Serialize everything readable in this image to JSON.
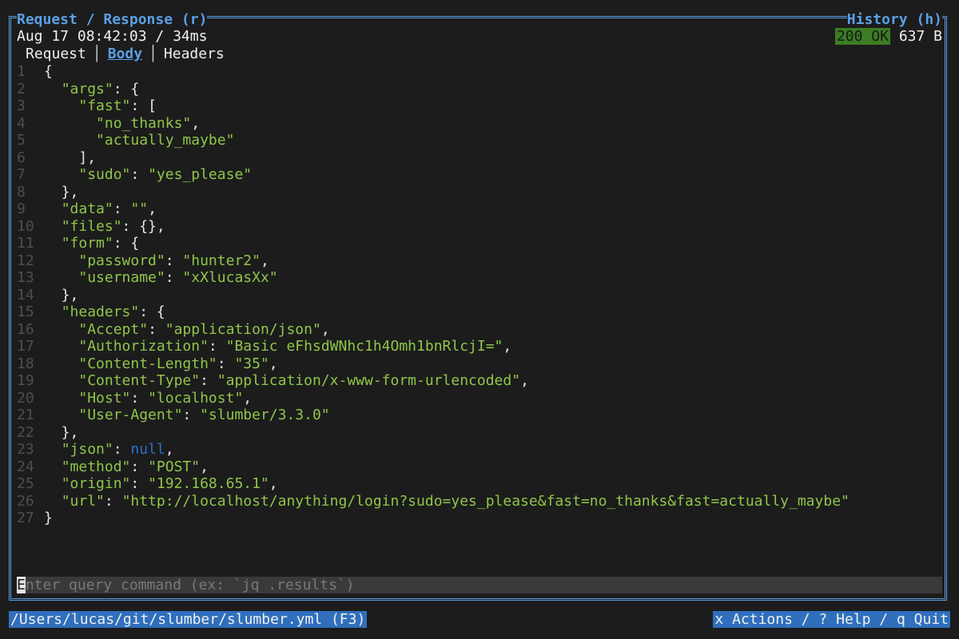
{
  "pane": {
    "title": "Request / Response (r)",
    "history_title": "History (h)"
  },
  "meta": {
    "timestamp": "Aug 17 08:42:03 / 34ms",
    "status": "200 OK",
    "size": "637 B"
  },
  "tabs": [
    {
      "label": "Request",
      "active": false
    },
    {
      "label": "Body",
      "active": true
    },
    {
      "label": "Headers",
      "active": false
    }
  ],
  "body_lines": [
    {
      "no": "1",
      "parts": [
        [
          "p",
          "{"
        ]
      ]
    },
    {
      "no": "2",
      "parts": [
        [
          "p",
          "  "
        ],
        [
          "k",
          "\"args\""
        ],
        [
          "p",
          ": {"
        ]
      ]
    },
    {
      "no": "3",
      "parts": [
        [
          "p",
          "    "
        ],
        [
          "k",
          "\"fast\""
        ],
        [
          "p",
          ": ["
        ]
      ]
    },
    {
      "no": "4",
      "parts": [
        [
          "p",
          "      "
        ],
        [
          "s",
          "\"no_thanks\""
        ],
        [
          "p",
          ","
        ]
      ]
    },
    {
      "no": "5",
      "parts": [
        [
          "p",
          "      "
        ],
        [
          "s",
          "\"actually_maybe\""
        ]
      ]
    },
    {
      "no": "6",
      "parts": [
        [
          "p",
          "    ],"
        ]
      ]
    },
    {
      "no": "7",
      "parts": [
        [
          "p",
          "    "
        ],
        [
          "k",
          "\"sudo\""
        ],
        [
          "p",
          ": "
        ],
        [
          "s",
          "\"yes_please\""
        ]
      ]
    },
    {
      "no": "8",
      "parts": [
        [
          "p",
          "  },"
        ]
      ]
    },
    {
      "no": "9",
      "parts": [
        [
          "p",
          "  "
        ],
        [
          "k",
          "\"data\""
        ],
        [
          "p",
          ": "
        ],
        [
          "s",
          "\"\""
        ],
        [
          "p",
          ","
        ]
      ]
    },
    {
      "no": "10",
      "parts": [
        [
          "p",
          "  "
        ],
        [
          "k",
          "\"files\""
        ],
        [
          "p",
          ": {},"
        ]
      ]
    },
    {
      "no": "11",
      "parts": [
        [
          "p",
          "  "
        ],
        [
          "k",
          "\"form\""
        ],
        [
          "p",
          ": {"
        ]
      ]
    },
    {
      "no": "12",
      "parts": [
        [
          "p",
          "    "
        ],
        [
          "k",
          "\"password\""
        ],
        [
          "p",
          ": "
        ],
        [
          "s",
          "\"hunter2\""
        ],
        [
          "p",
          ","
        ]
      ]
    },
    {
      "no": "13",
      "parts": [
        [
          "p",
          "    "
        ],
        [
          "k",
          "\"username\""
        ],
        [
          "p",
          ": "
        ],
        [
          "s",
          "\"xXlucasXx\""
        ]
      ]
    },
    {
      "no": "14",
      "parts": [
        [
          "p",
          "  },"
        ]
      ]
    },
    {
      "no": "15",
      "parts": [
        [
          "p",
          "  "
        ],
        [
          "k",
          "\"headers\""
        ],
        [
          "p",
          ": {"
        ]
      ]
    },
    {
      "no": "16",
      "parts": [
        [
          "p",
          "    "
        ],
        [
          "k",
          "\"Accept\""
        ],
        [
          "p",
          ": "
        ],
        [
          "s",
          "\"application/json\""
        ],
        [
          "p",
          ","
        ]
      ]
    },
    {
      "no": "17",
      "parts": [
        [
          "p",
          "    "
        ],
        [
          "k",
          "\"Authorization\""
        ],
        [
          "p",
          ": "
        ],
        [
          "s",
          "\"Basic eFhsdWNhc1h4Omh1bnRlcjI=\""
        ],
        [
          "p",
          ","
        ]
      ]
    },
    {
      "no": "18",
      "parts": [
        [
          "p",
          "    "
        ],
        [
          "k",
          "\"Content-Length\""
        ],
        [
          "p",
          ": "
        ],
        [
          "s",
          "\"35\""
        ],
        [
          "p",
          ","
        ]
      ]
    },
    {
      "no": "19",
      "parts": [
        [
          "p",
          "    "
        ],
        [
          "k",
          "\"Content-Type\""
        ],
        [
          "p",
          ": "
        ],
        [
          "s",
          "\"application/x-www-form-urlencoded\""
        ],
        [
          "p",
          ","
        ]
      ]
    },
    {
      "no": "20",
      "parts": [
        [
          "p",
          "    "
        ],
        [
          "k",
          "\"Host\""
        ],
        [
          "p",
          ": "
        ],
        [
          "s",
          "\"localhost\""
        ],
        [
          "p",
          ","
        ]
      ]
    },
    {
      "no": "21",
      "parts": [
        [
          "p",
          "    "
        ],
        [
          "k",
          "\"User-Agent\""
        ],
        [
          "p",
          ": "
        ],
        [
          "s",
          "\"slumber/3.3.0\""
        ]
      ]
    },
    {
      "no": "22",
      "parts": [
        [
          "p",
          "  },"
        ]
      ]
    },
    {
      "no": "23",
      "parts": [
        [
          "p",
          "  "
        ],
        [
          "k",
          "\"json\""
        ],
        [
          "p",
          ": "
        ],
        [
          "n",
          "null"
        ],
        [
          "p",
          ","
        ]
      ]
    },
    {
      "no": "24",
      "parts": [
        [
          "p",
          "  "
        ],
        [
          "k",
          "\"method\""
        ],
        [
          "p",
          ": "
        ],
        [
          "s",
          "\"POST\""
        ],
        [
          "p",
          ","
        ]
      ]
    },
    {
      "no": "25",
      "parts": [
        [
          "p",
          "  "
        ],
        [
          "k",
          "\"origin\""
        ],
        [
          "p",
          ": "
        ],
        [
          "s",
          "\"192.168.65.1\""
        ],
        [
          "p",
          ","
        ]
      ]
    },
    {
      "no": "26",
      "parts": [
        [
          "p",
          "  "
        ],
        [
          "k",
          "\"url\""
        ],
        [
          "p",
          ": "
        ],
        [
          "s",
          "\"http://localhost/anything/login?sudo=yes_please&fast=no_thanks&fast=actually_maybe\""
        ]
      ]
    },
    {
      "no": "27",
      "parts": [
        [
          "p",
          "}"
        ]
      ]
    }
  ],
  "query": {
    "cursor_char": "E",
    "placeholder_rest": "nter query command (ex: `jq .results`)"
  },
  "footer": {
    "path": "/Users/lucas/git/slumber/slumber.yml (F3)",
    "shortcuts": "x Actions / ? Help / q Quit"
  },
  "colors": {
    "accent": "#5aa0e6",
    "status_ok": "#3c7d24",
    "json_string": "#8fc649",
    "json_null": "#2e6fd0",
    "footer_bg": "#2f6fbd"
  }
}
